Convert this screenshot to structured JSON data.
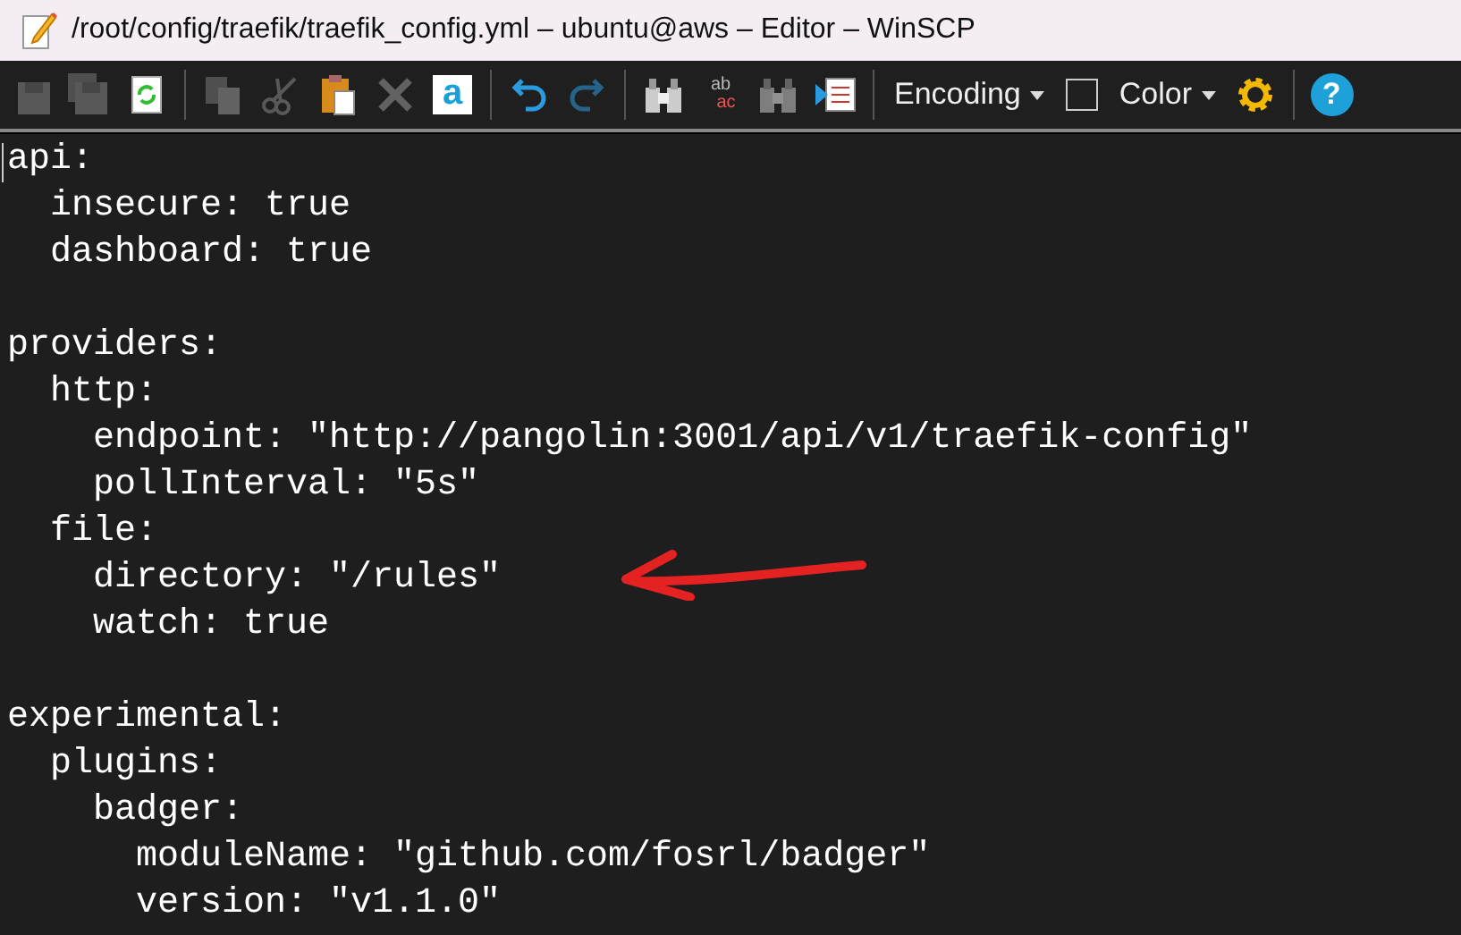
{
  "window": {
    "title": "/root/config/traefik/traefik_config.yml – ubuntu@aws – Editor – WinSCP"
  },
  "toolbar": [
    {
      "kind": "save",
      "disabled": true
    },
    {
      "kind": "save-all",
      "disabled": true
    },
    {
      "kind": "reload",
      "disabled": false
    },
    {
      "kind": "separator"
    },
    {
      "kind": "copy",
      "disabled": true
    },
    {
      "kind": "cut",
      "disabled": true
    },
    {
      "kind": "paste",
      "disabled": false
    },
    {
      "kind": "delete",
      "disabled": true
    },
    {
      "kind": "select-all",
      "disabled": false,
      "label": "a"
    },
    {
      "kind": "separator"
    },
    {
      "kind": "undo",
      "disabled": false
    },
    {
      "kind": "redo",
      "disabled": true
    },
    {
      "kind": "separator"
    },
    {
      "kind": "find",
      "disabled": false
    },
    {
      "kind": "replace",
      "disabled": false,
      "label": "ab",
      "label2": "ac"
    },
    {
      "kind": "find-next",
      "disabled": true
    },
    {
      "kind": "goto",
      "disabled": false
    },
    {
      "kind": "separator"
    },
    {
      "kind": "dropdown",
      "label": "Encoding"
    },
    {
      "kind": "checkbox",
      "checked": false
    },
    {
      "kind": "dropdown",
      "label": "Color"
    },
    {
      "kind": "settings",
      "disabled": false
    },
    {
      "kind": "separator"
    },
    {
      "kind": "help",
      "disabled": false,
      "label": "?"
    }
  ],
  "editor": {
    "blocks": [
      [
        "api:",
        "  insecure: true",
        "  dashboard: true"
      ],
      [
        "providers:",
        "  http:",
        "    endpoint: \"http://pangolin:3001/api/v1/traefik-config\"",
        "    pollInterval: \"5s\"",
        "  file:",
        "    directory: \"/rules\"",
        "    watch: true"
      ],
      [
        "experimental:",
        "  plugins:",
        "    badger:",
        "      moduleName: \"github.com/fosrl/badger\"",
        "      version: \"v1.1.0\""
      ]
    ]
  }
}
